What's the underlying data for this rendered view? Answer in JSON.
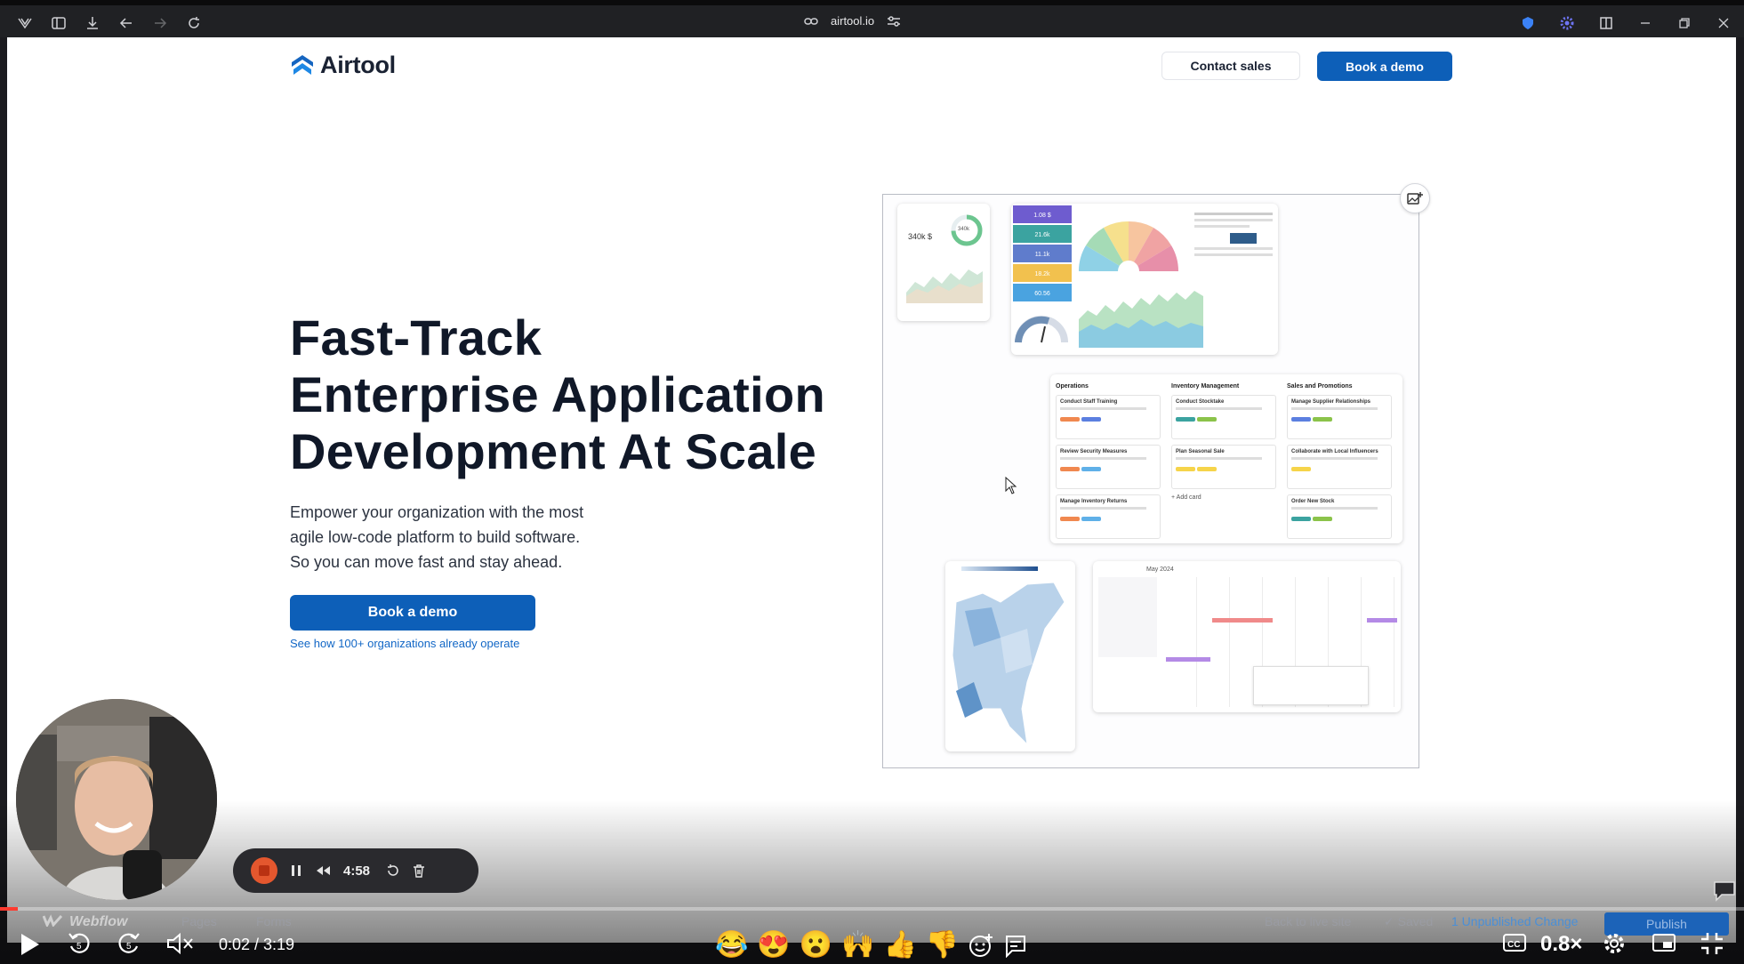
{
  "browser": {
    "url": "airtool.io"
  },
  "header": {
    "logo_text": "Airtool",
    "contact_label": "Contact sales",
    "demo_label": "Book a demo"
  },
  "hero": {
    "title_line1": "Fast-Track",
    "title_line2": "Enterprise Application",
    "title_line3": "Development At Scale",
    "sub_line1": "Empower your organization with the most",
    "sub_line2": "agile low-code platform to build software.",
    "sub_line3": "So you can move fast and stay ahead.",
    "cta_label": "Book a demo",
    "link_text": "See how 100+ organizations already operate"
  },
  "collage": {
    "metric_value": "340k $",
    "gauge_value": "340k",
    "kpi_values": [
      "1.08 $",
      "21.6k",
      "11.1k",
      "18.2k",
      "60.56"
    ],
    "kanban_columns": [
      "Operations",
      "Inventory Management",
      "Sales and Promotions"
    ],
    "kanban_cards": [
      [
        "Conduct Staff Training",
        "Review Security Measures",
        "Manage Inventory Returns"
      ],
      [
        "Conduct Stocktake",
        "Plan Seasonal Sale"
      ],
      [
        "Manage Supplier Relationships",
        "Collaborate with Local Influencers",
        "Order New Stock"
      ]
    ],
    "add_card": "+ Add card",
    "calendar_month": "May 2024"
  },
  "recorder": {
    "time": "4:58"
  },
  "webflow": {
    "brand": "Webflow",
    "pages": "Pages",
    "forms": "Forms",
    "back_live": "Back to live site",
    "saved": "✓ Saved",
    "unpublished": "1 Unpublished Change",
    "publish": "Publish"
  },
  "player": {
    "current_time": "0:02",
    "duration": "3:19",
    "time_display": "0:02 / 3:19",
    "progress_fraction": 0.01,
    "speed": "0.8×",
    "reactions": [
      "😂",
      "😍",
      "😮",
      "🙌",
      "👍",
      "👎"
    ]
  },
  "colors": {
    "brand_blue": "#0d5fb8",
    "record_red": "#e4572e",
    "progress_red": "#ff3b30"
  }
}
